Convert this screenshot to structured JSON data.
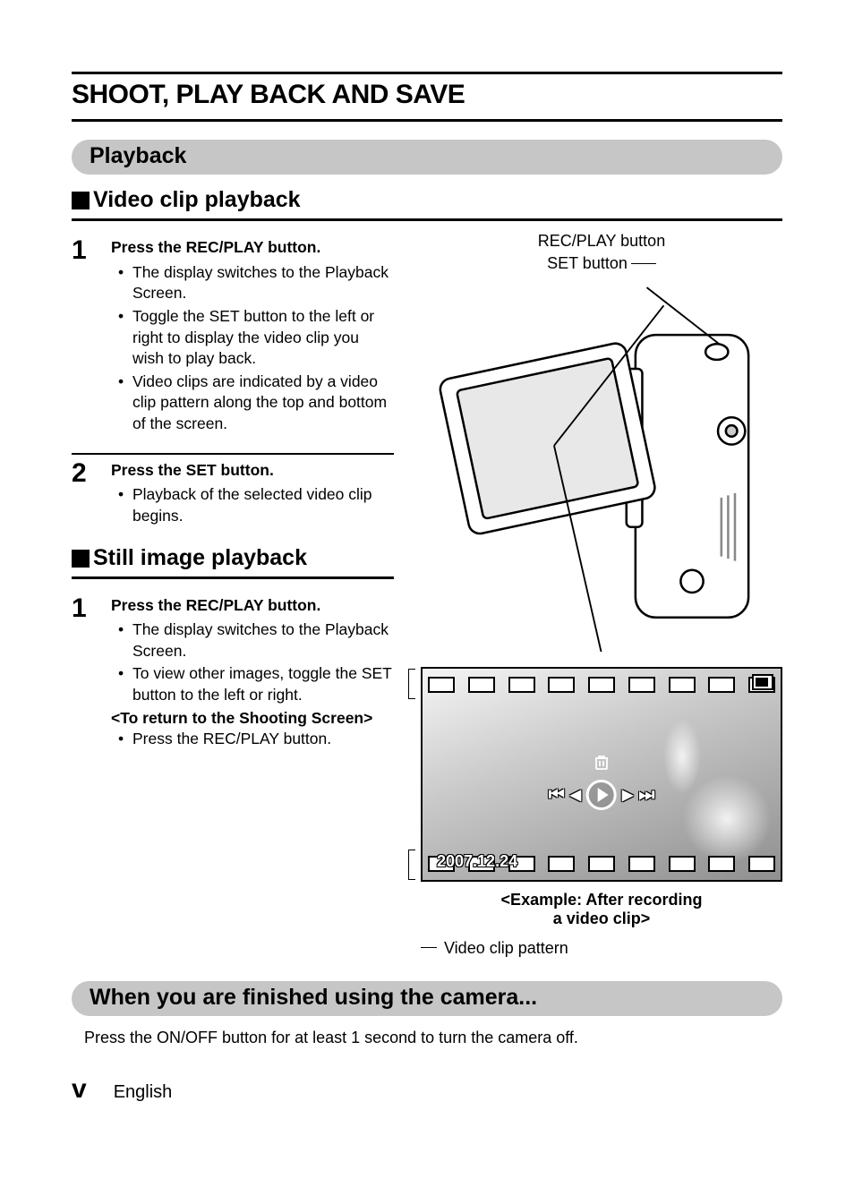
{
  "title": "SHOOT, PLAY BACK AND SAVE",
  "section1": {
    "heading": "Playback"
  },
  "sub1": {
    "heading": "Video clip playback"
  },
  "step1": {
    "num": "1",
    "lead": "Press the REC/PLAY button.",
    "b1": "The display switches to the Playback Screen.",
    "b2": "Toggle the SET button to the left or right to display the video clip you wish to play back.",
    "b3": "Video clips are indicated by a video clip pattern along the top and bottom of the screen."
  },
  "step2": {
    "num": "2",
    "lead": "Press the SET button.",
    "b1": "Playback of the selected video clip begins."
  },
  "sub2": {
    "heading": "Still image playback"
  },
  "step3": {
    "num": "1",
    "lead": "Press the REC/PLAY button.",
    "b1": "The display switches to the Playback Screen.",
    "b2": "To view other images, toggle the SET button to the left or right.",
    "note": "<To return to the Shooting Screen>",
    "b3": "Press the REC/PLAY button."
  },
  "diagram": {
    "recplay_label": "REC/PLAY button",
    "set_label": "SET button",
    "date": "2007.12.24",
    "caption_l1": "<Example: After recording",
    "caption_l2": "a video clip>",
    "vcp": "Video clip pattern"
  },
  "section2": {
    "heading": "When you are finished using the camera...",
    "body": "Press the ON/OFF button for at least 1 second to turn the camera off."
  },
  "footer": {
    "page": "v",
    "lang": "English"
  }
}
